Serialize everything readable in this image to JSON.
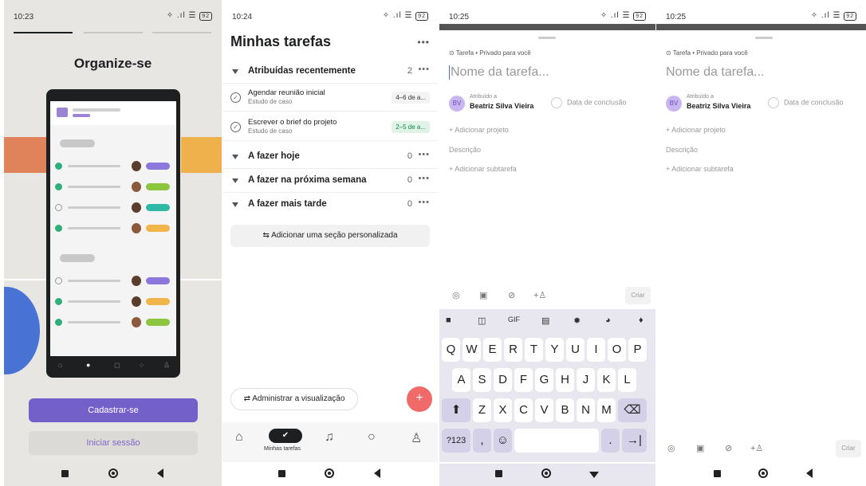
{
  "p1": {
    "time": "10:23",
    "signal": "✧ .ıl ☰",
    "battery": "92",
    "title": "Organize-se",
    "signup": "Cadastrar-se",
    "login": "Iniciar sessão"
  },
  "p2": {
    "time": "10:24",
    "signal": "✧ .ıl ☰",
    "battery": "92",
    "title": "Minhas tarefas",
    "menu": "•••",
    "sections": [
      {
        "name": "Atribuídas recentemente",
        "count": "2"
      },
      {
        "name": "A fazer hoje",
        "count": "0"
      },
      {
        "name": "A fazer na próxima semana",
        "count": "0"
      },
      {
        "name": "A fazer mais tarde",
        "count": "0"
      }
    ],
    "tasks": [
      {
        "name": "Agendar reunião inicial",
        "sub": "Estudo de caso",
        "due": "4–6 de a..."
      },
      {
        "name": "Escrever o brief do projeto",
        "sub": "Estudo de caso",
        "due": "2–5 de a..."
      }
    ],
    "add_section": "Adicionar uma seção personalizada",
    "manage": "Administrar a visualização",
    "nav_label": "Minhas tarefas",
    "fab": "+"
  },
  "p3": {
    "time": "10:25",
    "signal": "✧ .ıl ☰",
    "battery": "92",
    "meta": "⊙ Tarefa • Privado para você",
    "placeholder": "Nome da tarefa...",
    "assigned_to": "Atribuído a",
    "assignee": "Beatriz Silva Vieira",
    "initials": "BV",
    "due": "Data de conclusão",
    "add_project": "+ Adicionar projeto",
    "desc": "Descrição",
    "add_sub": "+ Adicionar subtarefa",
    "create": "Criar",
    "kb_row1": [
      "Q",
      "W",
      "E",
      "R",
      "T",
      "Y",
      "U",
      "I",
      "O",
      "P"
    ],
    "kb_row2": [
      "A",
      "S",
      "D",
      "F",
      "G",
      "H",
      "J",
      "K",
      "L"
    ],
    "kb_row3": [
      "Z",
      "X",
      "C",
      "V",
      "B",
      "N",
      "M"
    ],
    "kb_num": "?123",
    "kb_comma": ",",
    "kb_dot": ".",
    "kb_gif": "GIF"
  },
  "p4": {
    "time": "10:25",
    "signal": "✧ .ıl ☰",
    "battery": "92",
    "meta": "⊙ Tarefa • Privado para você",
    "placeholder": "Nome da tarefa...",
    "assigned_to": "Atribuído a",
    "assignee": "Beatriz Silva Vieira",
    "initials": "BV",
    "due": "Data de conclusão",
    "add_project": "+ Adicionar projeto",
    "desc": "Descrição",
    "add_sub": "+ Adicionar subtarefa",
    "create": "Criar"
  }
}
